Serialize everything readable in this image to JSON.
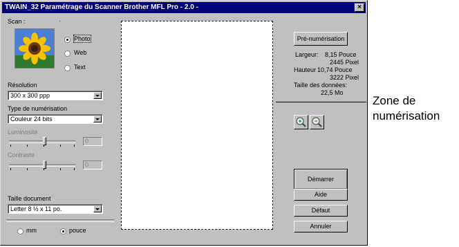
{
  "window": {
    "title": "TWAIN_32 Paramétrage du Scanner Brother MFL Pro - 2.0 -",
    "close": "×"
  },
  "scan": {
    "label": "Scan :",
    "options": [
      "Photo",
      "Web",
      "Text"
    ],
    "selected": "Photo"
  },
  "resolution": {
    "label": "Résolution",
    "value": "300 x 300 ppp"
  },
  "scan_type": {
    "label": "Type de numérisation",
    "value": "Couleur 24 bits"
  },
  "brightness": {
    "label": "Luminosité",
    "value": "0"
  },
  "contrast": {
    "label": "Contraste",
    "value": "0"
  },
  "doc_size": {
    "label": "Taille document",
    "value": "Letter 8 ½ x 11 po."
  },
  "units": {
    "options": [
      "mm",
      "pouce"
    ],
    "selected": "pouce"
  },
  "right": {
    "prescan": "Pré-numérisation",
    "width_label": "Largeur:",
    "width_in": "8,15 Pouce",
    "width_px": "2445 Pixel",
    "height_label": "Hauteur",
    "height_in": "10,74 Pouce",
    "height_px": "3222 Pixel",
    "data_size_label": "Taille des données:",
    "data_size": "22,5 Mo",
    "start": "Démarrer",
    "help": "Aide",
    "default": "Défaut",
    "cancel": "Annuler"
  },
  "callout": {
    "line1": "Zone de",
    "line2": "numérisation"
  },
  "icons": {
    "zoom_in": "zoom-in-icon",
    "zoom_out": "zoom-out-icon",
    "thumbnail": "sunflower-thumbnail"
  },
  "colors": {
    "titlebar": "#00007b",
    "face": "#c0c0c0"
  }
}
